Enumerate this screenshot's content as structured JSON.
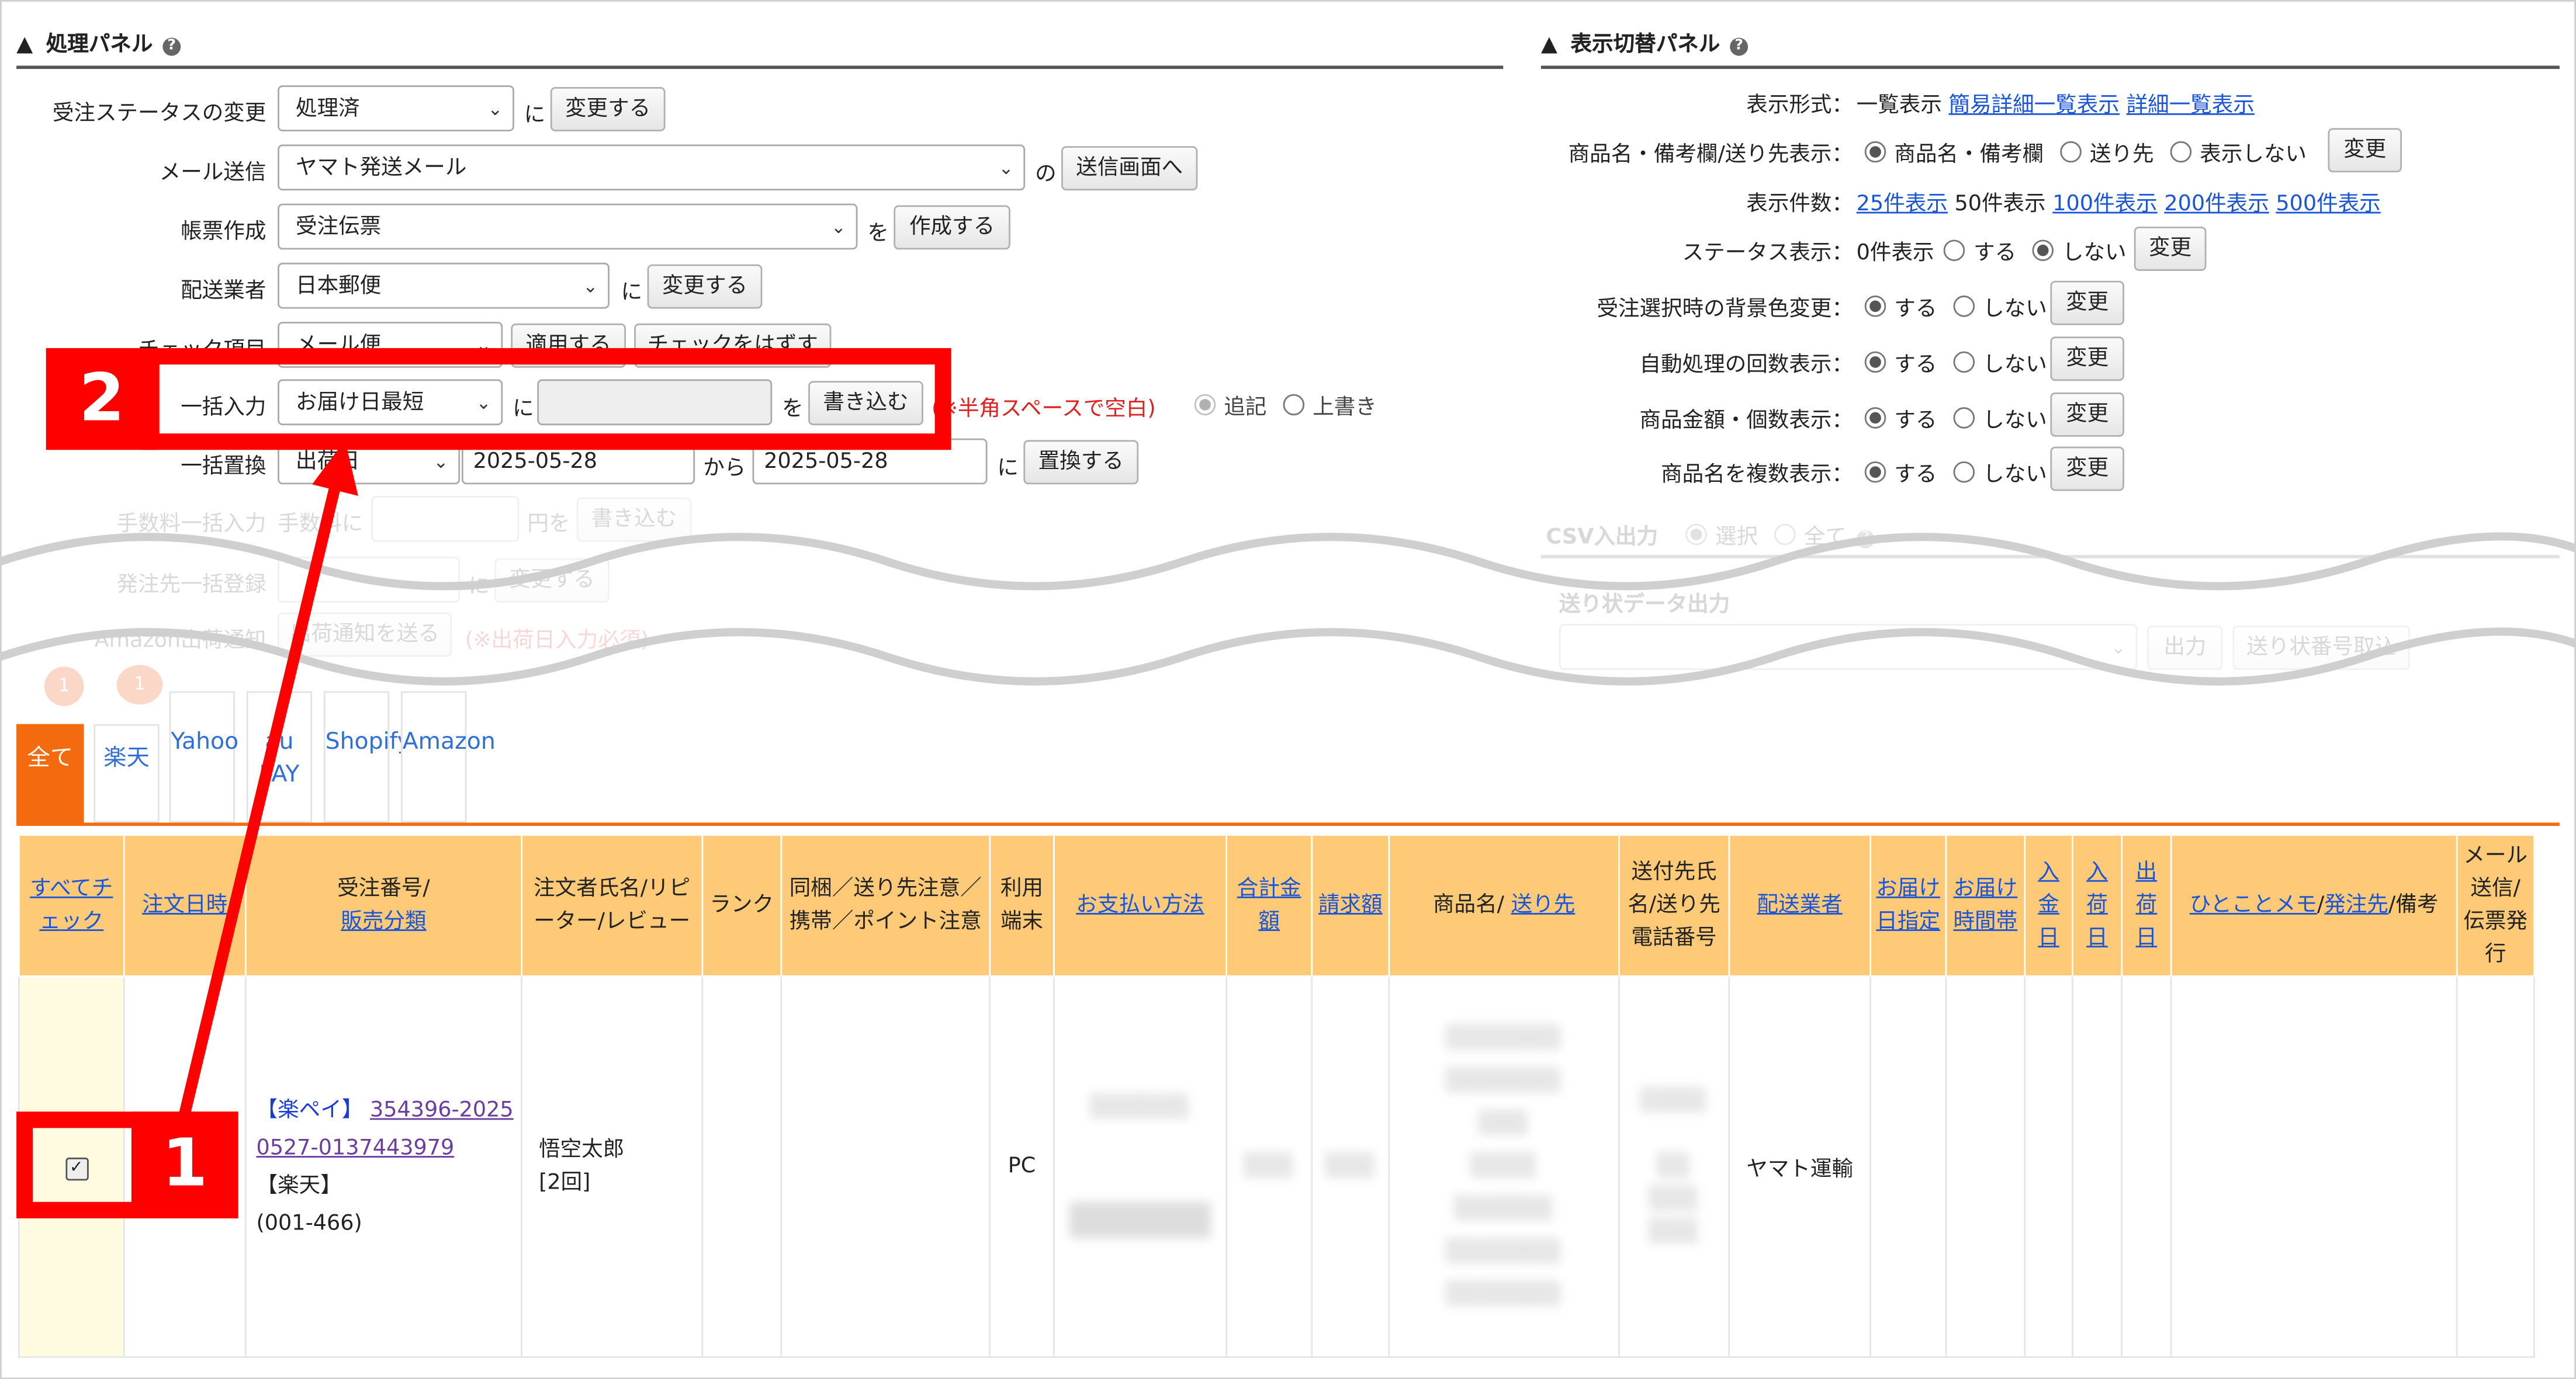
{
  "left_panel": {
    "title": "処理パネル",
    "rows": {
      "status_label": "受注ステータスの変更",
      "status_value": "処理済",
      "status_suffix": "に",
      "status_button": "変更する",
      "mail_label": "メール送信",
      "mail_value": "ヤマト発送メール",
      "mail_suffix": "の",
      "mail_button": "送信画面へ",
      "form_label": "帳票作成",
      "form_value": "受注伝票",
      "form_suffix": "を",
      "form_button": "作成する",
      "carrier_label": "配送業者",
      "carrier_value": "日本郵便",
      "carrier_suffix": "に",
      "carrier_button": "変更する",
      "check_label": "チェック項目",
      "check_value": "メール便",
      "check_apply_button": "適用する",
      "check_remove_button": "チェックをはずす",
      "bulk_label": "一括入力",
      "bulk_value": "お届け日最短",
      "bulk_suffix": "に",
      "bulk_input": "",
      "bulk_suffix2": "を",
      "bulk_button": "書き込む",
      "bulk_note": "(※半角スペースで空白)",
      "bulk_append": "追記",
      "bulk_overwrite": "上書き",
      "replace_label": "一括置換",
      "replace_value": "出荷日",
      "replace_from": "2025-05-28",
      "replace_from_suffix": "から",
      "replace_to": "2025-05-28",
      "replace_to_suffix": "に",
      "replace_button": "置換する",
      "fee_label": "手数料一括入力",
      "fee_sub": "手数料に",
      "fee_unit": "円を",
      "fee_button": "書き込む",
      "order_label": "発注先一括登録",
      "order_suffix": "に",
      "order_button": "変更する",
      "amazon_label": "Amazon出荷通知",
      "amazon_button": "出荷通知を送る",
      "amazon_note": "(※出荷日入力必須)"
    }
  },
  "right_panel": {
    "title": "表示切替パネル",
    "format_label": "表示形式：",
    "format_current": "一覧表示",
    "format_link1": "簡易詳細一覧表示",
    "format_link2": "詳細一覧表示",
    "name_label": "商品名・備考欄/送り先表示：",
    "name_opt1": "商品名・備考欄",
    "name_opt2": "送り先",
    "name_opt3": "表示しない",
    "change": "変更",
    "count_label": "表示件数：",
    "count_25": "25件表示",
    "count_50": "50件表示",
    "count_100": "100件表示",
    "count_200": "200件表示",
    "count_500": "500件表示",
    "status_label": "ステータス表示：",
    "status_zero": "0件表示",
    "yes": "する",
    "no": "しない",
    "bg_label": "受注選択時の背景色変更：",
    "auto_label": "自動処理の回数表示：",
    "amount_label": "商品金額・個数表示：",
    "multi_label": "商品名を複数表示：",
    "csv_label": "CSV入出力",
    "csv_opt1": "選択",
    "csv_opt2": "全て",
    "ship_label": "送り状データ出力",
    "ship_button1": "出力",
    "ship_button2": "送り状番号取込"
  },
  "tabs": [
    "全て",
    "楽天",
    "Yahoo",
    "au PAY",
    "Shopify",
    "Amazon"
  ],
  "tab_badges": [
    "1",
    "1"
  ],
  "table": {
    "headers": {
      "check_all": "すべてチェック",
      "order_date": "注文日時",
      "order_no_a": "受注番号/",
      "order_no_b": "販売分類",
      "customer": "注文者氏名/リピーター/レビュー",
      "rank": "ランク",
      "bundle": "同梱／送り先注意／携帯／ポイント注意",
      "device": "利用端末",
      "payment": "お支払い方法",
      "total": "合計金額",
      "billed": "請求額",
      "product_a": "商品名/",
      "product_b": "送り先",
      "recipient": "送付先氏名/送り先電話番号",
      "carrier": "配送業者",
      "delivery_date": "お届け日指定",
      "delivery_time": "お届け時間帯",
      "paid_date": "入金日",
      "arrival_date": "入荷日",
      "ship_date": "出荷日",
      "memo_a": "ひとことメモ",
      "memo_b": "発注先",
      "memo_c": "備考",
      "mail": "メール送信/伝票発行"
    },
    "row": {
      "shop_tag": "【楽ペイ】",
      "order_no": "354396-20250527-0137443979",
      "channel": "【楽天】",
      "code": "(001-466)",
      "customer": "悟空太郎",
      "repeat": "[2回]",
      "device": "PC",
      "carrier": "ヤマト運輸"
    }
  },
  "annotations": {
    "label1": "1",
    "label2": "2"
  },
  "colors": {
    "accent_orange": "#f46a0e",
    "header_orange": "#ffca78",
    "annotation_red": "#ff0000",
    "link_blue": "#1a55d8"
  }
}
